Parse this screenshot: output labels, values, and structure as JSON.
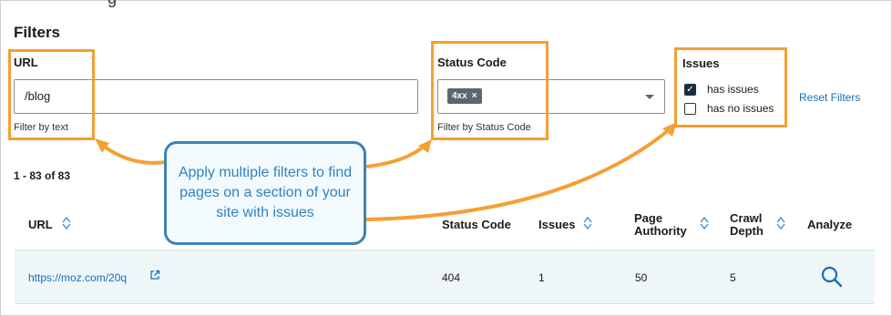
{
  "page": {
    "partial_title": "g",
    "filters_title": "Filters"
  },
  "url_filter": {
    "label": "URL",
    "value": "/blog",
    "helper": "Filter by text"
  },
  "status_filter": {
    "label": "Status Code",
    "chip": "4xx",
    "chip_remove": "×",
    "helper": "Filter by Status Code"
  },
  "issues_filter": {
    "label": "Issues",
    "options": [
      {
        "label": "has issues",
        "checked": true
      },
      {
        "label": "has no issues",
        "checked": false
      }
    ]
  },
  "reset_filters": "Reset Filters",
  "results_count": "1 - 83 of 83",
  "callout": "Apply multiple filters to find pages on a section of your site with issues",
  "table": {
    "headers": {
      "url": "URL",
      "status": "Status Code",
      "issues": "Issues",
      "pa_line1": "Page",
      "pa_line2": "Authority",
      "cd_line1": "Crawl",
      "cd_line2": "Depth",
      "analyze": "Analyze"
    },
    "rows": [
      {
        "url": "https://moz.com/20q",
        "status": "404",
        "issues": "1",
        "page_authority": "50",
        "crawl_depth": "5"
      }
    ]
  },
  "icons": [
    "sort-icon",
    "external-link-icon",
    "search-icon",
    "chevron-down-icon",
    "close-icon",
    "checkmark-icon"
  ],
  "colors": {
    "annotation_orange": "#f4a033",
    "callout_blue": "#3d83b3",
    "link_blue": "#1a6fb5",
    "chip_gray": "#5b6770",
    "row_highlight": "#eef6f8"
  }
}
